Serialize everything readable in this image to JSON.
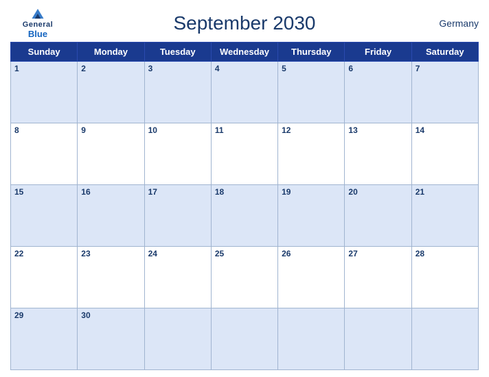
{
  "header": {
    "logo": {
      "general": "General",
      "blue": "Blue"
    },
    "title": "September 2030",
    "country": "Germany"
  },
  "calendar": {
    "weekdays": [
      "Sunday",
      "Monday",
      "Tuesday",
      "Wednesday",
      "Thursday",
      "Friday",
      "Saturday"
    ],
    "weeks": [
      [
        {
          "day": "1",
          "empty": false
        },
        {
          "day": "2",
          "empty": false
        },
        {
          "day": "3",
          "empty": false
        },
        {
          "day": "4",
          "empty": false
        },
        {
          "day": "5",
          "empty": false
        },
        {
          "day": "6",
          "empty": false
        },
        {
          "day": "7",
          "empty": false
        }
      ],
      [
        {
          "day": "8",
          "empty": false
        },
        {
          "day": "9",
          "empty": false
        },
        {
          "day": "10",
          "empty": false
        },
        {
          "day": "11",
          "empty": false
        },
        {
          "day": "12",
          "empty": false
        },
        {
          "day": "13",
          "empty": false
        },
        {
          "day": "14",
          "empty": false
        }
      ],
      [
        {
          "day": "15",
          "empty": false
        },
        {
          "day": "16",
          "empty": false
        },
        {
          "day": "17",
          "empty": false
        },
        {
          "day": "18",
          "empty": false
        },
        {
          "day": "19",
          "empty": false
        },
        {
          "day": "20",
          "empty": false
        },
        {
          "day": "21",
          "empty": false
        }
      ],
      [
        {
          "day": "22",
          "empty": false
        },
        {
          "day": "23",
          "empty": false
        },
        {
          "day": "24",
          "empty": false
        },
        {
          "day": "25",
          "empty": false
        },
        {
          "day": "26",
          "empty": false
        },
        {
          "day": "27",
          "empty": false
        },
        {
          "day": "28",
          "empty": false
        }
      ],
      [
        {
          "day": "29",
          "empty": false
        },
        {
          "day": "30",
          "empty": false
        },
        {
          "day": "",
          "empty": true
        },
        {
          "day": "",
          "empty": true
        },
        {
          "day": "",
          "empty": true
        },
        {
          "day": "",
          "empty": true
        },
        {
          "day": "",
          "empty": true
        }
      ]
    ]
  }
}
